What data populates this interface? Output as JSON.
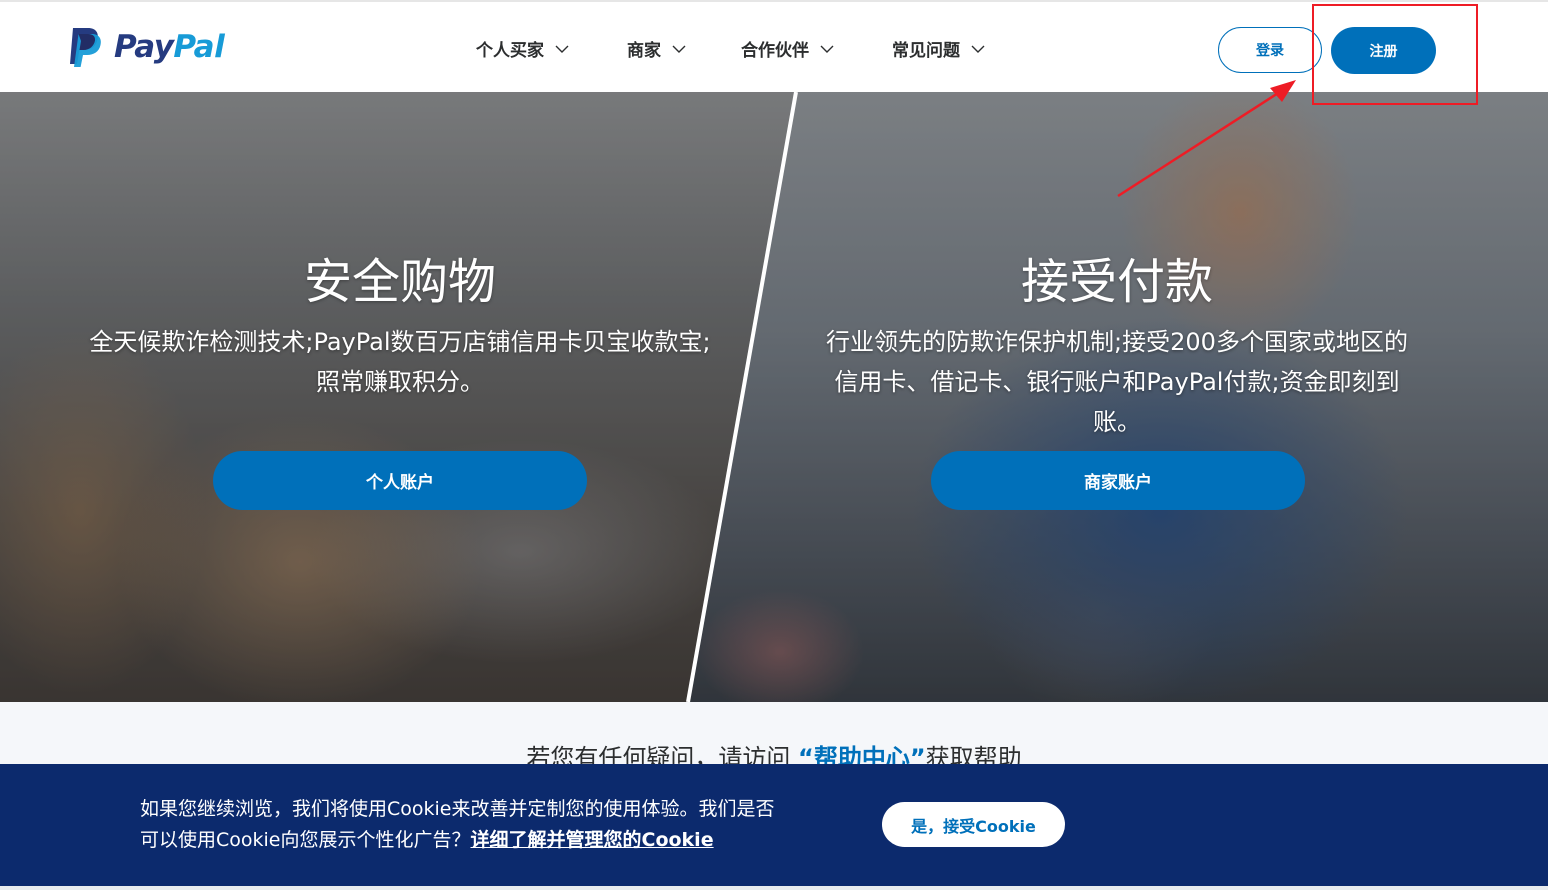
{
  "header": {
    "logo_text_pay": "Pay",
    "logo_text_pal": "Pal",
    "nav": [
      {
        "label": "个人买家"
      },
      {
        "label": "商家"
      },
      {
        "label": "合作伙伴"
      },
      {
        "label": "常见问题"
      }
    ],
    "login_label": "登录",
    "signup_label": "注册"
  },
  "hero": {
    "personal": {
      "title": "安全购物",
      "desc_line1": "全天候欺诈检测技术;PayPal数百万店铺信用卡贝宝收款宝;",
      "desc_line2": "照常赚取积分。",
      "button": "个人账户"
    },
    "business": {
      "title": "接受付款",
      "desc_line1": "行业领先的防欺诈保护机制;接受200多个国家或地区的",
      "desc_line2": "信用卡、借记卡、银行账户和PayPal付款;资金即刻到",
      "desc_line3": "账。",
      "button": "商家账户"
    }
  },
  "help": {
    "prefix": "若您有任何疑问，请访问 ",
    "link": "“帮助中心”",
    "suffix": "获取帮助"
  },
  "cookie": {
    "text_line1": "如果您继续浏览，我们将使用Cookie来改善并定制您的使用体验。我们是否",
    "text_line2": "可以使用Cookie向您展示个性化广告？",
    "link": "详细了解并管理您的Cookie",
    "accept": "是，接受Cookie"
  },
  "colors": {
    "brand_blue": "#0070ba",
    "logo_dark": "#253b80",
    "logo_light": "#179bd7",
    "cookie_bg": "#0c2a6d",
    "annotation_red": "#ee1c25"
  },
  "icons": {
    "logo": "paypal-p-logo",
    "nav_chevron": "chevron-down-icon"
  }
}
